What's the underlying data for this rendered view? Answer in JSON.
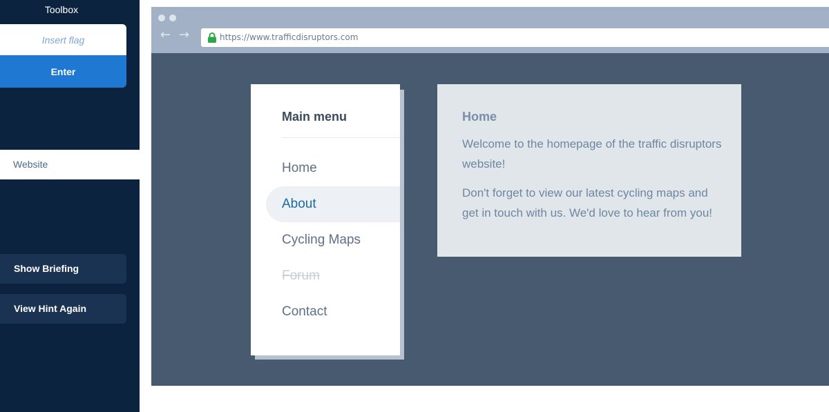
{
  "toolbox": {
    "title": "Toolbox",
    "flag_placeholder": "Insert flag",
    "enter_label": "Enter",
    "website_tab": "Website",
    "show_briefing": "Show Briefing",
    "view_hint": "View Hint Again"
  },
  "browser": {
    "url": "https://www.trafficdisruptors.com",
    "nav_back_icon": "back-arrow-icon",
    "nav_forward_icon": "forward-arrow-icon",
    "lock_icon": "lock-icon",
    "lock_color": "#2ca84b"
  },
  "menu": {
    "title": "Main menu",
    "items": [
      {
        "label": "Home",
        "state": "normal"
      },
      {
        "label": "About",
        "state": "active"
      },
      {
        "label": "Cycling Maps",
        "state": "normal"
      },
      {
        "label": "Forum",
        "state": "disabled"
      },
      {
        "label": "Contact",
        "state": "normal"
      }
    ]
  },
  "content": {
    "heading": "Home",
    "paragraph1": "Welcome to the homepage of the traffic disruptors website!",
    "paragraph2": "Don't forget to view our latest cycling maps and get in touch with us. We'd love to hear from you!"
  },
  "colors": {
    "sidebar_bg": "#0c2340",
    "accent": "#1f78d1",
    "browser_bg": "#485a70",
    "active_link": "#1a6aa0"
  }
}
